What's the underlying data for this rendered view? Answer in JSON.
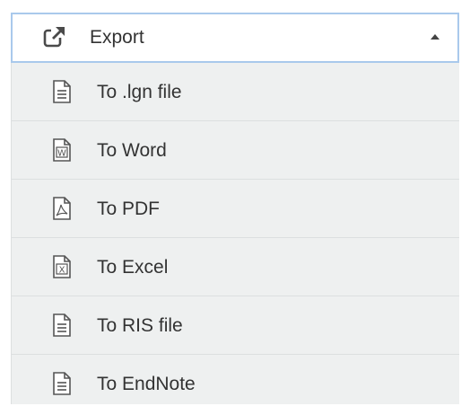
{
  "export_menu": {
    "header": {
      "label": "Export",
      "icon": "external-link-icon"
    },
    "items": [
      {
        "label": "To .lgn file",
        "icon": "text-file-icon"
      },
      {
        "label": "To Word",
        "icon": "word-file-icon",
        "badge": "W"
      },
      {
        "label": "To PDF",
        "icon": "pdf-file-icon"
      },
      {
        "label": "To Excel",
        "icon": "excel-file-icon",
        "badge": "X"
      },
      {
        "label": "To RIS file",
        "icon": "text-file-icon"
      },
      {
        "label": "To EndNote",
        "icon": "text-file-icon"
      }
    ]
  },
  "colors": {
    "header_border": "#a9c9ec",
    "menu_background": "#eef0f0",
    "text": "#333333"
  }
}
